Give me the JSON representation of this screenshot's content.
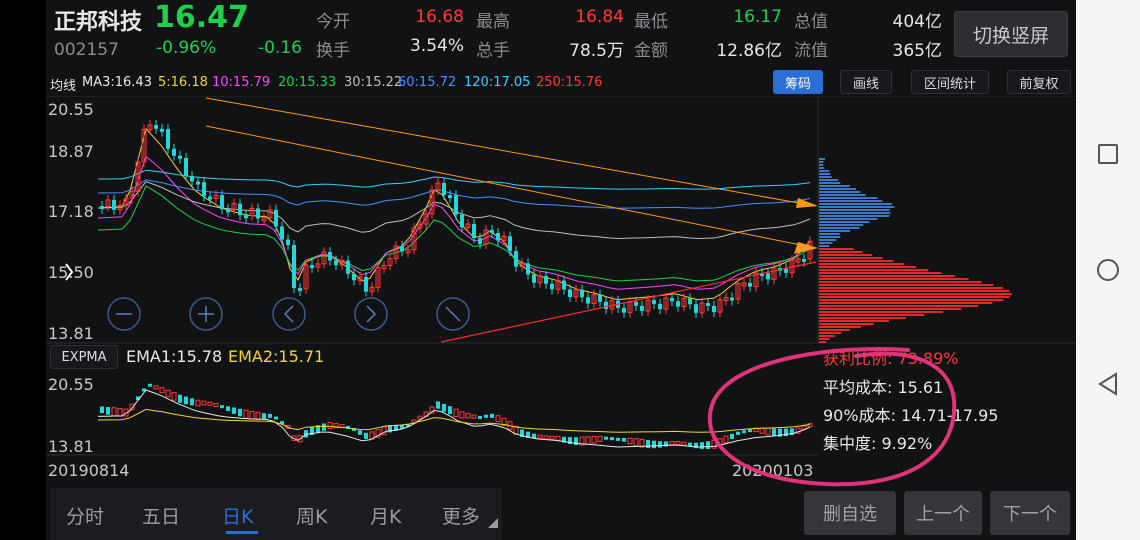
{
  "header": {
    "stock_name": "正邦科技",
    "price": "16.47",
    "code": "002157",
    "change_pct": "-0.96%",
    "change_abs": "-0.16",
    "stats": [
      {
        "label": "今开",
        "value": "16.68",
        "color": "#ff3a3a"
      },
      {
        "label": "最高",
        "value": "16.84",
        "color": "#ff3a3a"
      },
      {
        "label": "最低",
        "value": "16.17",
        "color": "#1fd14a"
      },
      {
        "label": "总值",
        "value": "404亿",
        "color": "#e8e8e8"
      },
      {
        "label": "换手",
        "value": "3.54%",
        "color": "#e8e8e8"
      },
      {
        "label": "总手",
        "value": "78.5万",
        "color": "#e8e8e8"
      },
      {
        "label": "金额",
        "value": "12.86亿",
        "color": "#e8e8e8"
      },
      {
        "label": "流值",
        "value": "365亿",
        "color": "#e8e8e8"
      }
    ],
    "switch_button": "切换竖屏"
  },
  "ma_bar": {
    "items": [
      {
        "text": "均线",
        "color": "#e8e8e8"
      },
      {
        "text": "MA3:16.43",
        "color": "#e8e8e8"
      },
      {
        "text": "5:16.18",
        "color": "#f2d635"
      },
      {
        "text": "10:15.79",
        "color": "#ff44ff"
      },
      {
        "text": "20:15.33",
        "color": "#1fd14a"
      },
      {
        "text": "30:15.22",
        "color": "#bdbdbd"
      },
      {
        "text": "60:15.72",
        "color": "#4a90ff"
      },
      {
        "text": "120:17.05",
        "color": "#39d0ff"
      },
      {
        "text": "250:15.76",
        "color": "#ff3a3a"
      }
    ],
    "buttons": [
      "筹码",
      "画线",
      "区间统计",
      "前复权"
    ]
  },
  "main_chart": {
    "price_labels": [
      "20.55",
      "18.87",
      "17.18",
      "15.50",
      "13.81"
    ]
  },
  "sub_chart": {
    "indicator_button": "EXPMA",
    "ema1": "EMA1:15.78",
    "ema2": "EMA2:15.71",
    "price_labels": [
      "20.55",
      "13.81"
    ]
  },
  "chip_stats": {
    "profit": "获利比例: 73.89%",
    "avg_cost": "平均成本: 15.61",
    "cost90": "90%成本: 14.71-17.95",
    "concentration": "集中度: 9.92%"
  },
  "dates": {
    "start": "20190814",
    "end": "20200103"
  },
  "tabs": [
    "分时",
    "五日",
    "日K",
    "周K",
    "月K",
    "更多"
  ],
  "active_tab": "日K",
  "bottom_buttons": [
    "删自选",
    "上一个",
    "下一个"
  ],
  "colors": {
    "up": "#ff3a3a",
    "down": "#1fd14a",
    "accent": "#2a6fd6",
    "annotation": "#e0337a"
  }
}
